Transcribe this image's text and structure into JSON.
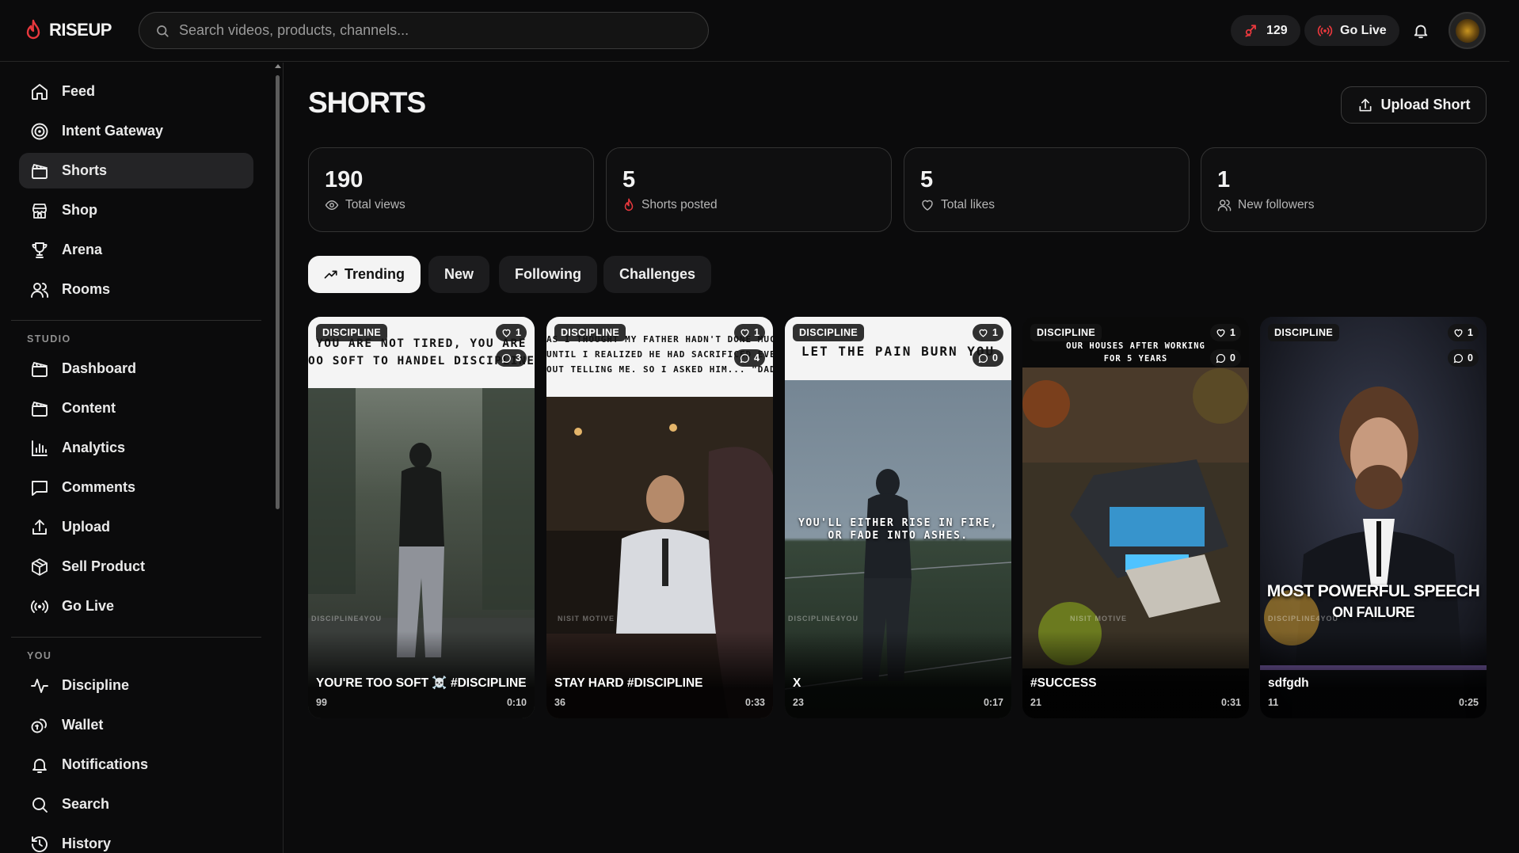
{
  "brand": {
    "name": "RISEUP",
    "accent": "#e8383d"
  },
  "search": {
    "placeholder": "Search videos, products, channels..."
  },
  "header": {
    "streak_count": "129",
    "go_live_label": "Go Live"
  },
  "sidebar": {
    "main_items": [
      {
        "label": "Feed",
        "icon": "home-icon"
      },
      {
        "label": "Intent Gateway",
        "icon": "target-icon"
      },
      {
        "label": "Shorts",
        "icon": "clapperboard-icon",
        "active": true
      },
      {
        "label": "Shop",
        "icon": "store-icon"
      },
      {
        "label": "Arena",
        "icon": "trophy-icon"
      },
      {
        "label": "Rooms",
        "icon": "users-icon"
      }
    ],
    "studio_heading": "STUDIO",
    "studio_items": [
      {
        "label": "Dashboard",
        "icon": "clapperboard-icon"
      },
      {
        "label": "Content",
        "icon": "clapperboard-icon"
      },
      {
        "label": "Analytics",
        "icon": "bar-chart-icon"
      },
      {
        "label": "Comments",
        "icon": "comment-icon"
      },
      {
        "label": "Upload",
        "icon": "upload-icon"
      },
      {
        "label": "Sell Product",
        "icon": "package-icon"
      },
      {
        "label": "Go Live",
        "icon": "broadcast-icon"
      }
    ],
    "you_heading": "YOU",
    "you_items": [
      {
        "label": "Discipline",
        "icon": "activity-icon"
      },
      {
        "label": "Wallet",
        "icon": "coins-icon"
      },
      {
        "label": "Notifications",
        "icon": "bell-icon"
      },
      {
        "label": "Search",
        "icon": "search-icon"
      },
      {
        "label": "History",
        "icon": "history-icon"
      }
    ]
  },
  "page": {
    "title": "SHORTS",
    "upload_label": "Upload Short"
  },
  "stats": [
    {
      "value": "190",
      "label": "Total views",
      "icon": "eye-icon"
    },
    {
      "value": "5",
      "label": "Shorts posted",
      "icon": "flame-icon"
    },
    {
      "value": "5",
      "label": "Total likes",
      "icon": "heart-icon"
    },
    {
      "value": "1",
      "label": "New followers",
      "icon": "users-icon"
    }
  ],
  "tabs": [
    {
      "label": "Trending",
      "active": true
    },
    {
      "label": "New"
    },
    {
      "label": "Following"
    },
    {
      "label": "Challenges"
    }
  ],
  "shorts": [
    {
      "tag": "DISCIPLINE",
      "likes": "1",
      "comments": "3",
      "caption_line1": "YOU ARE NOT TIRED, YOU ARE",
      "caption_line2": "OO SOFT TO HANDEL DISCIPLINE",
      "watermark": "DISCIPLINE4YOU",
      "title": "YOU'RE TOO SOFT ☠️ #DISCIPLINE",
      "views": "99",
      "duration": "0:10"
    },
    {
      "tag": "DISCIPLINE",
      "likes": "1",
      "comments": "4",
      "caption_line1": "AS I THOUGHT MY FATHER HADN'T DONE MUCH",
      "caption_line2": "UNTIL I REALIZED HE HAD SACRIFICED EVERY",
      "caption_line3": "OUT TELLING ME. SO I ASKED HIM... \"DAD...",
      "watermark": "NISIT MOTIVE",
      "title": "STAY HARD #DISCIPLINE",
      "views": "36",
      "duration": "0:33"
    },
    {
      "tag": "DISCIPLINE",
      "likes": "1",
      "comments": "0",
      "caption_line1": "LET THE PAIN BURN YOU",
      "overlay_line1": "YOU'LL EITHER RISE IN FIRE,",
      "overlay_line2": "OR FADE INTO ASHES.",
      "watermark": "DISCIPLINE4YOU",
      "title": "X",
      "views": "23",
      "duration": "0:17"
    },
    {
      "tag": "DISCIPLINE",
      "likes": "1",
      "comments": "0",
      "caption_line1": "OUR HOUSES AFTER WORKING",
      "caption_line2": "FOR 5 YEARS",
      "watermark": "NISIT MOTIVE",
      "title": "#SUCCESS",
      "views": "21",
      "duration": "0:31"
    },
    {
      "tag": "DISCIPLINE",
      "likes": "1",
      "comments": "0",
      "overlay_line1": "MOST POWERFUL SPEECH",
      "overlay_line2": "ON FAILURE",
      "watermark": "DISCIPLINE4YOU",
      "title": "sdfgdh",
      "views": "11",
      "duration": "0:25"
    }
  ]
}
